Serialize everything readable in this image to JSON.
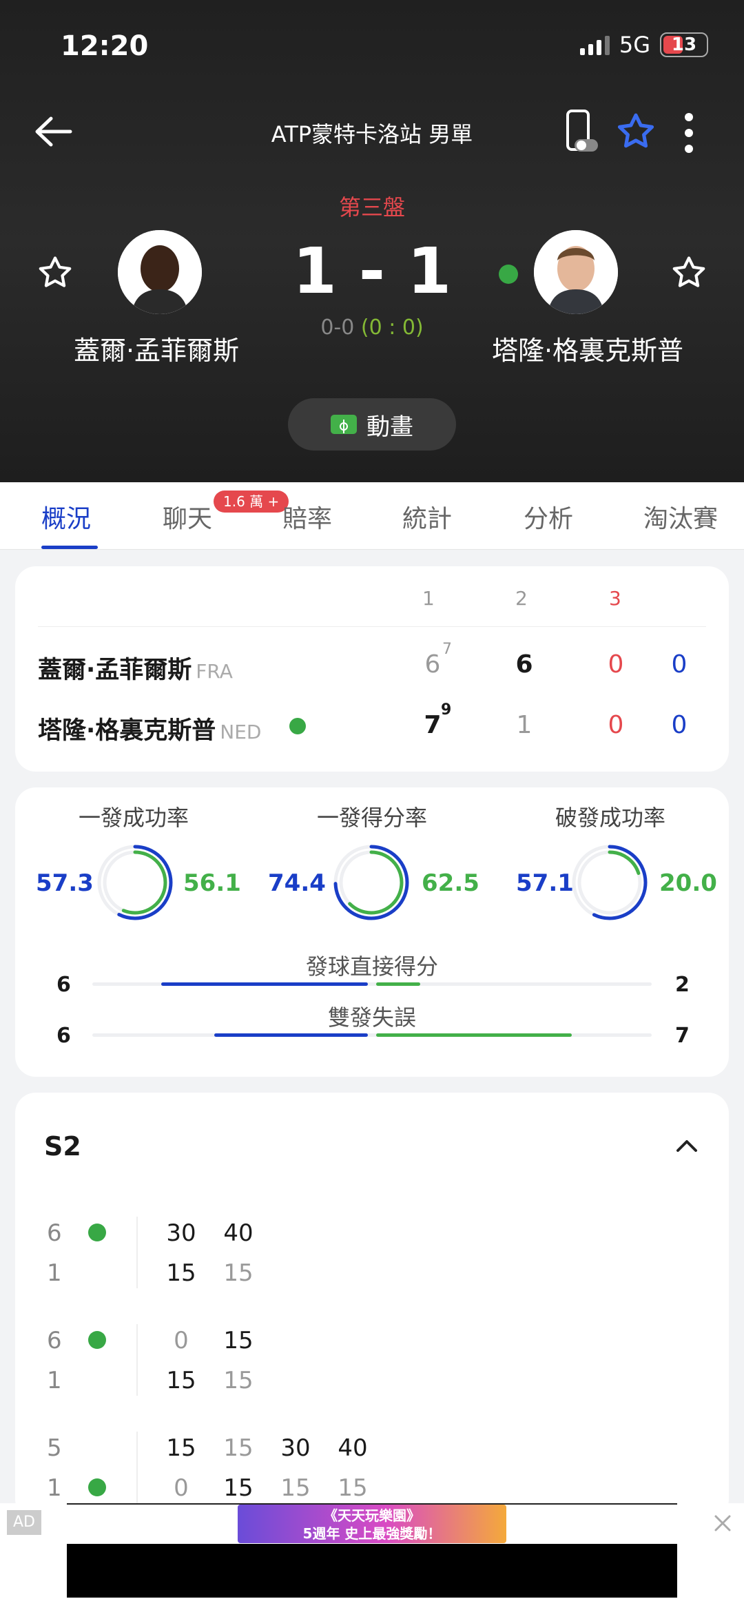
{
  "status": {
    "time": "12:20",
    "network": "5G",
    "battery": "13"
  },
  "header": {
    "title": "ATP蒙特卡洛站 男單",
    "set_label": "第三盤",
    "score": "1 - 1",
    "game_score_prefix": "0-0",
    "point_score": "(0 : 0)",
    "player_left": "蓋爾·孟菲爾斯",
    "player_right": "塔隆·格裏克斯普",
    "animation_label": "動畫"
  },
  "tabs": [
    {
      "label": "概況"
    },
    {
      "label": "聊天",
      "badge": "1.6 萬 +"
    },
    {
      "label": "賠率"
    },
    {
      "label": "統計"
    },
    {
      "label": "分析"
    },
    {
      "label": "淘汰賽"
    }
  ],
  "scoreboard": {
    "sets_header": [
      "1",
      "2",
      "3"
    ],
    "rows": [
      {
        "name": "蓋爾·孟菲爾斯",
        "country": "FRA",
        "s1": "6",
        "s1_tb": "7",
        "s2": "6",
        "s3": "0",
        "pts": "0"
      },
      {
        "name": "塔隆·格裏克斯普",
        "country": "NED",
        "s1": "7",
        "s1_tb": "9",
        "s2": "1",
        "s3": "0",
        "pts": "0"
      }
    ]
  },
  "stats": {
    "rings": [
      {
        "title": "一發成功率",
        "left": "57.3",
        "right": "56.1",
        "left_val": 57.3,
        "right_val": 56.1
      },
      {
        "title": "一發得分率",
        "left": "74.4",
        "right": "62.5",
        "left_val": 74.4,
        "right_val": 62.5
      },
      {
        "title": "破發成功率",
        "left": "57.1",
        "right": "20.0",
        "left_val": 57.1,
        "right_val": 20.0
      }
    ],
    "bars": [
      {
        "label": "發球直接得分",
        "left": "6",
        "right": "2",
        "left_val": 6,
        "right_val": 2
      },
      {
        "label": "雙發失誤",
        "left": "6",
        "right": "7",
        "left_val": 6,
        "right_val": 7
      }
    ]
  },
  "point_by_point": {
    "title": "S2",
    "games": [
      {
        "top_game": "6",
        "bottom_game": "1",
        "top_pts": [
          "30",
          "40"
        ],
        "bottom_pts": [
          "15",
          "15"
        ]
      },
      {
        "top_game": "6",
        "bottom_game": "1",
        "top_pts": [
          "0",
          "15"
        ],
        "bottom_pts": [
          "15",
          "15"
        ]
      },
      {
        "top_game": "5",
        "bottom_game": "1",
        "top_pts": [
          "15",
          "15",
          "30",
          "40"
        ],
        "bottom_pts": [
          "0",
          "15",
          "15",
          "15"
        ]
      }
    ]
  },
  "ad": {
    "label": "AD",
    "banner_line1": "《天天玩樂園》",
    "banner_line2": "5週年 史上最強獎勵！"
  },
  "colors": {
    "blue": "#1a3ec7",
    "green": "#43b049",
    "red": "#e5484d"
  }
}
